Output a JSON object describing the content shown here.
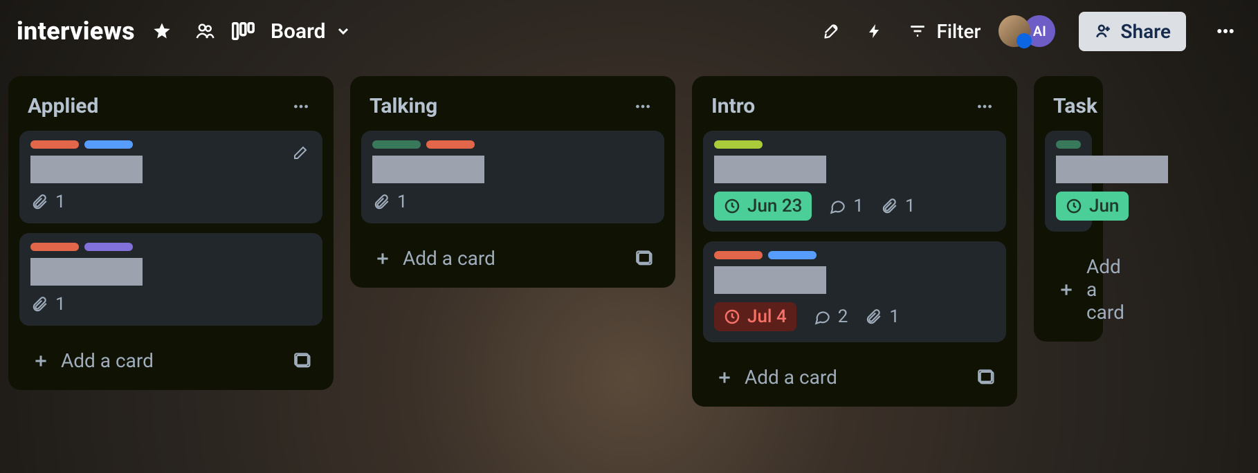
{
  "header": {
    "board_title": "interviews",
    "view_label": "Board",
    "filter_label": "Filter",
    "share_label": "Share",
    "member_initials": "AI"
  },
  "label_colors": {
    "salmon": "#e2674a",
    "blue": "#579dff",
    "purple": "#8270db",
    "green": "#38795b",
    "lime": "#aacb3a"
  },
  "lists": [
    {
      "title": "Applied",
      "add_label": "Add a card",
      "cards": [
        {
          "labels": [
            "salmon",
            "blue"
          ],
          "show_pencil": true,
          "attachments": "1"
        },
        {
          "labels": [
            "salmon",
            "purple"
          ],
          "attachments": "1"
        }
      ]
    },
    {
      "title": "Talking",
      "add_label": "Add a card",
      "cards": [
        {
          "labels": [
            "green",
            "salmon"
          ],
          "attachments": "1"
        }
      ]
    },
    {
      "title": "Intro",
      "add_label": "Add a card",
      "cards": [
        {
          "labels": [
            "lime"
          ],
          "due": {
            "text": "Jun 23",
            "tone": "green"
          },
          "comments": "1",
          "attachments": "1"
        },
        {
          "labels": [
            "salmon",
            "blue"
          ],
          "due": {
            "text": "Jul 4",
            "tone": "red"
          },
          "comments": "2",
          "attachments": "1"
        }
      ]
    },
    {
      "title": "Task",
      "add_label": "Add a card",
      "truncated": true,
      "cards": [
        {
          "labels": [
            "green"
          ],
          "due": {
            "text": "Jun",
            "tone": "green"
          }
        }
      ]
    }
  ]
}
